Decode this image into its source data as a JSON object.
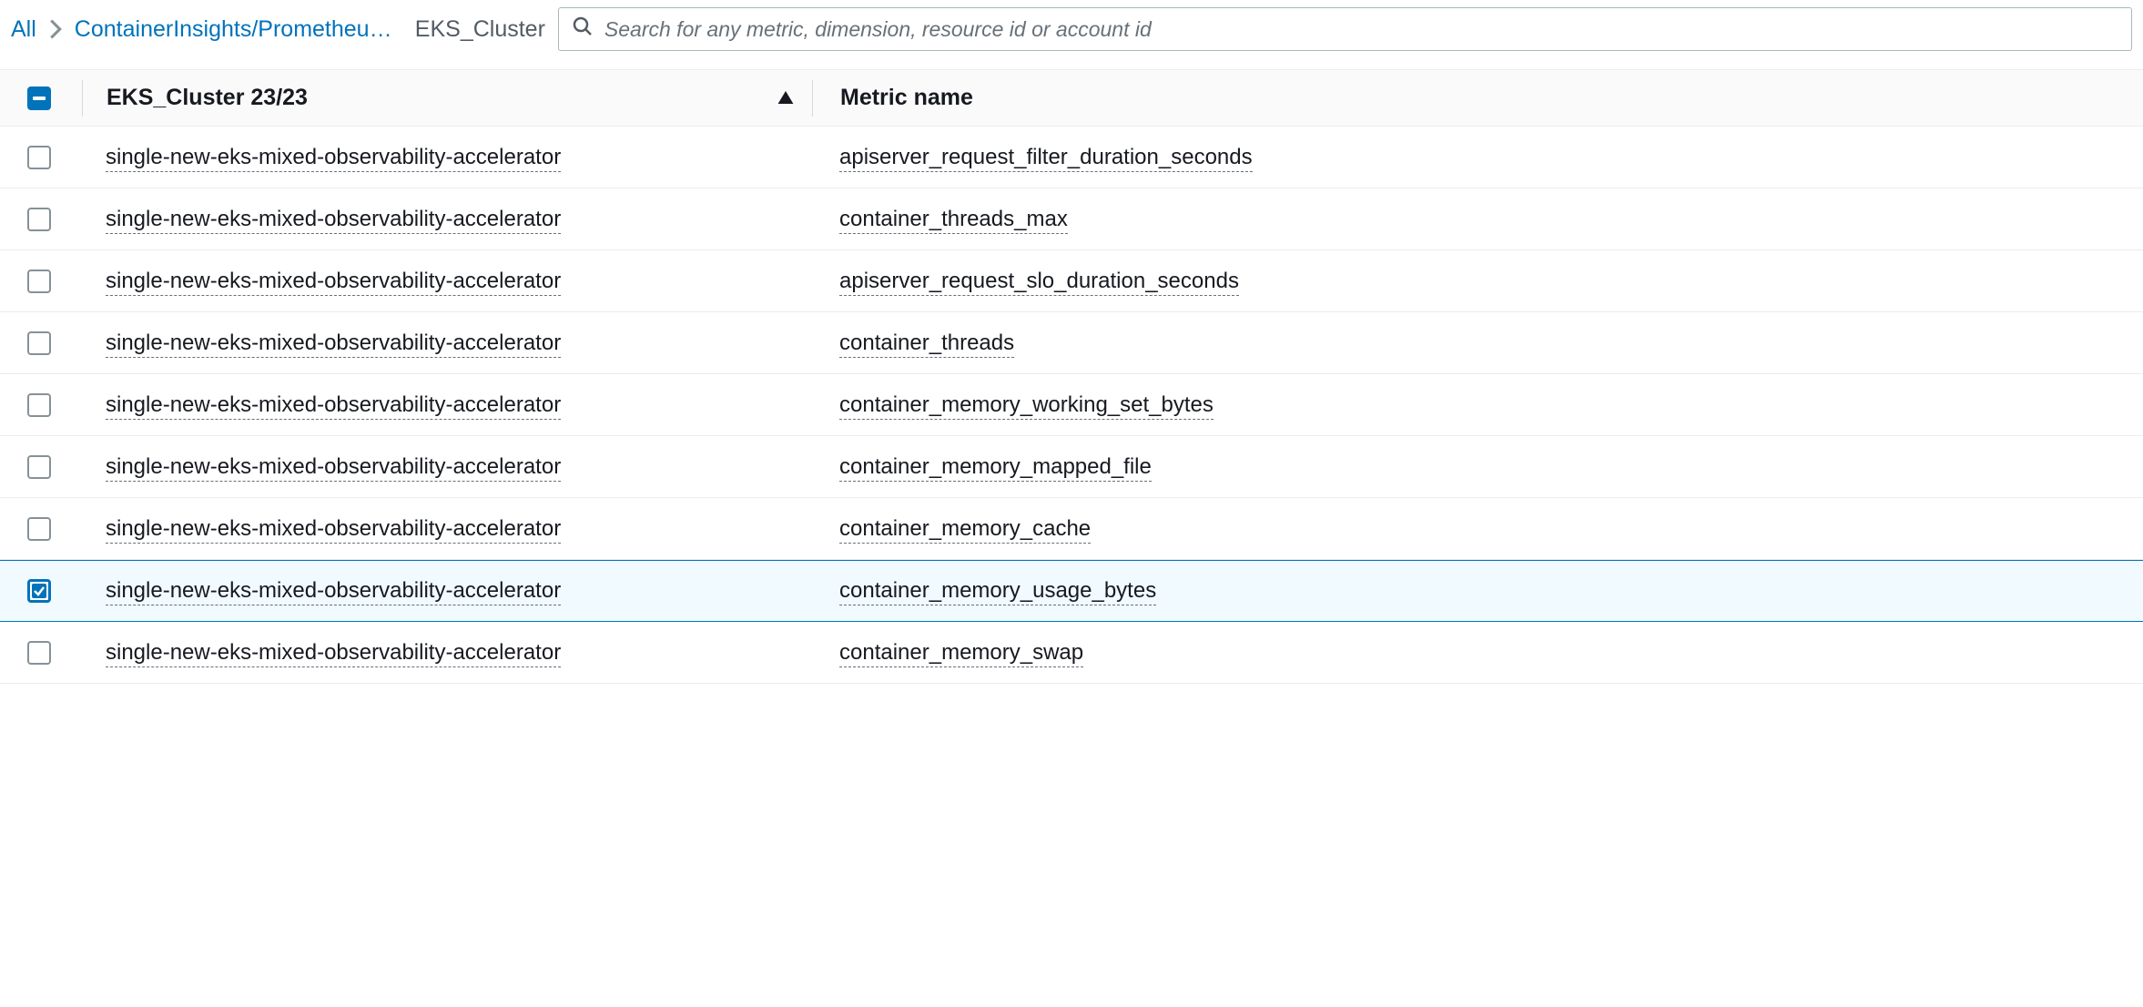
{
  "breadcrumb": {
    "all": "All",
    "namespace": "ContainerInsights/Prometheus…",
    "current": "EKS_Cluster"
  },
  "search": {
    "placeholder": "Search for any metric, dimension, resource id or account id"
  },
  "header": {
    "cluster_label": "EKS_Cluster 23/23",
    "metric_label": "Metric name"
  },
  "rows": [
    {
      "cluster": "single-new-eks-mixed-observability-accelerator",
      "metric": "apiserver_request_filter_duration_seconds",
      "selected": false
    },
    {
      "cluster": "single-new-eks-mixed-observability-accelerator",
      "metric": "container_threads_max",
      "selected": false
    },
    {
      "cluster": "single-new-eks-mixed-observability-accelerator",
      "metric": "apiserver_request_slo_duration_seconds",
      "selected": false
    },
    {
      "cluster": "single-new-eks-mixed-observability-accelerator",
      "metric": "container_threads",
      "selected": false
    },
    {
      "cluster": "single-new-eks-mixed-observability-accelerator",
      "metric": "container_memory_working_set_bytes",
      "selected": false
    },
    {
      "cluster": "single-new-eks-mixed-observability-accelerator",
      "metric": "container_memory_mapped_file",
      "selected": false
    },
    {
      "cluster": "single-new-eks-mixed-observability-accelerator",
      "metric": "container_memory_cache",
      "selected": false
    },
    {
      "cluster": "single-new-eks-mixed-observability-accelerator",
      "metric": "container_memory_usage_bytes",
      "selected": true
    },
    {
      "cluster": "single-new-eks-mixed-observability-accelerator",
      "metric": "container_memory_swap",
      "selected": false
    }
  ]
}
